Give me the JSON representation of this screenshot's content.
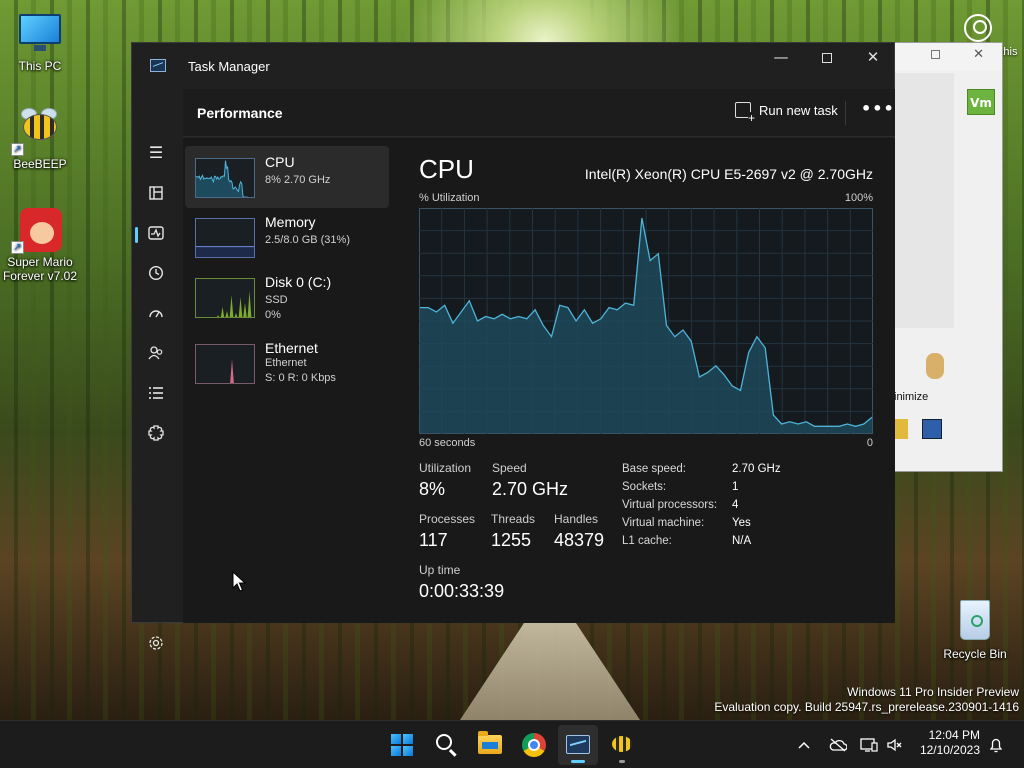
{
  "desktop": {
    "icons": [
      {
        "label": "This PC",
        "icon": "this-pc-icon"
      },
      {
        "label": "BeeBEEP",
        "icon": "beebeep-icon"
      },
      {
        "label": "Super Mario Forever v7.02",
        "icon": "mario-icon"
      },
      {
        "label": "Recycle Bin",
        "icon": "recycle-bin-icon"
      }
    ],
    "learn_label": "Learn about this picture",
    "watermark_line1": "Windows 11 Pro Insider Preview",
    "watermark_line2": "Evaluation copy. Build 25947.rs_prerelease.230901-1416"
  },
  "background_window": {
    "badge": "Vm",
    "minimize_label": "inimize"
  },
  "task_manager": {
    "title": "Task Manager",
    "window_controls": {
      "minimize": "—",
      "close": "✕"
    },
    "rail_icons": [
      "hamburger-menu-icon",
      "processes-icon",
      "performance-icon",
      "app-history-icon",
      "startup-apps-icon",
      "users-icon",
      "details-icon",
      "services-icon",
      "settings-icon"
    ],
    "header": {
      "page_title": "Performance",
      "run_new_task": "Run new task",
      "more": "•••"
    },
    "sidebar": [
      {
        "name": "CPU",
        "line1": "8% 2.70 GHz",
        "line2": "",
        "active": true
      },
      {
        "name": "Memory",
        "line1": "2.5/8.0 GB (31%)",
        "line2": ""
      },
      {
        "name": "Disk 0 (C:)",
        "line1": "SSD",
        "line2": "0%"
      },
      {
        "name": "Ethernet",
        "line1": "Ethernet",
        "line2": "S: 0  R: 0 Kbps"
      }
    ],
    "cpu": {
      "title": "CPU",
      "model": "Intel(R) Xeon(R) CPU E5-2697 v2 @ 2.70GHz",
      "graph_label_top_left": "% Utilization",
      "graph_label_top_right": "100%",
      "graph_label_bottom_left": "60 seconds",
      "graph_label_bottom_right": "0",
      "stats": {
        "utilization_label": "Utilization",
        "utilization": "8%",
        "speed_label": "Speed",
        "speed": "2.70 GHz",
        "processes_label": "Processes",
        "processes": "117",
        "threads_label": "Threads",
        "threads": "1255",
        "handles_label": "Handles",
        "handles": "48379",
        "uptime_label": "Up time",
        "uptime": "0:00:33:39"
      },
      "details": [
        {
          "key": "Base speed:",
          "value": "2.70 GHz"
        },
        {
          "key": "Sockets:",
          "value": "1"
        },
        {
          "key": "Virtual processors:",
          "value": "4"
        },
        {
          "key": "Virtual machine:",
          "value": "Yes"
        },
        {
          "key": "L1 cache:",
          "value": "N/A"
        }
      ]
    },
    "colors": {
      "graph_line": "#4fb3d9",
      "graph_fill": "#1d4a5c",
      "accent": "#60cdff"
    }
  },
  "chart_data": {
    "type": "area",
    "title": "",
    "xlabel": "60 seconds",
    "ylabel": "% Utilization",
    "x_range": [
      60,
      0
    ],
    "ylim": [
      0,
      100
    ],
    "grid": true,
    "series": [
      {
        "values": [
          56,
          56,
          54,
          57,
          49,
          54,
          59,
          50,
          52,
          51,
          53,
          51,
          52,
          51,
          55,
          48,
          43,
          57,
          56,
          50,
          55,
          49,
          51,
          56,
          55,
          58,
          57,
          96,
          77,
          80,
          48,
          43,
          46,
          41,
          25,
          27,
          30,
          26,
          21,
          19,
          36,
          43,
          38,
          8,
          4,
          5,
          4,
          5,
          3,
          3,
          3,
          3,
          4,
          3,
          4,
          7
        ]
      }
    ],
    "thumbnails": {
      "memory_level": 31,
      "disk_spikes": [
        10,
        30,
        20,
        60,
        15,
        55,
        40,
        70
      ],
      "ethernet_spike": 65
    }
  },
  "taskbar": {
    "apps": [
      "start-icon",
      "search-icon",
      "file-explorer-icon",
      "chrome-icon",
      "task-manager-icon",
      "beebeep-icon"
    ],
    "tray_icons": [
      "chevron-up-icon",
      "onedrive-icon",
      "network-icon",
      "volume-icon",
      "notifications-icon"
    ],
    "time": "12:04 PM",
    "date": "12/10/2023"
  }
}
